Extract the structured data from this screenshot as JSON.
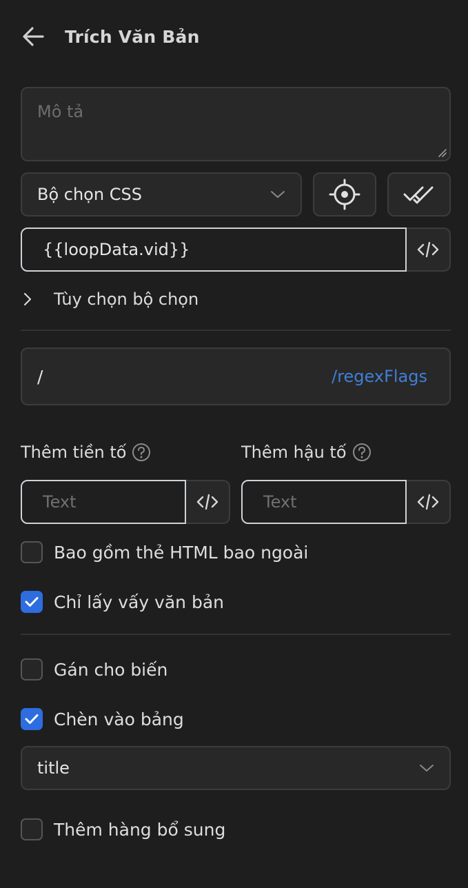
{
  "header": {
    "title": "Trích Văn Bản",
    "back_icon": "arrow-left-icon"
  },
  "description": {
    "placeholder": "Mô tả",
    "value": ""
  },
  "selector": {
    "type_value": "Bộ chọn CSS",
    "value": "{{loopData.vid}}",
    "options_label": "Tùy chọn bộ chọn"
  },
  "regex": {
    "pattern": "/",
    "flags_placeholder": "/regexFlags",
    "flags_color": "#3f7fd7"
  },
  "prefix": {
    "label": "Thêm tiền tố",
    "placeholder": "Text"
  },
  "suffix": {
    "label": "Thêm hậu tố",
    "placeholder": "Text"
  },
  "checkboxes": {
    "include_html": {
      "label": "Bao gồm thẻ HTML bao ngoài",
      "checked": false
    },
    "only_text": {
      "label": "Chỉ lấy vấy văn bản",
      "checked": true
    },
    "assign_variable": {
      "label": "Gán cho biến",
      "checked": false
    },
    "insert_table": {
      "label": "Chèn vào bảng",
      "checked": true
    },
    "add_row": {
      "label": "Thêm hàng bổ sung",
      "checked": false
    }
  },
  "table_column": {
    "value": "title"
  },
  "colors": {
    "accent": "#2d6de0",
    "background": "#1e1e1e",
    "field": "#282828"
  }
}
